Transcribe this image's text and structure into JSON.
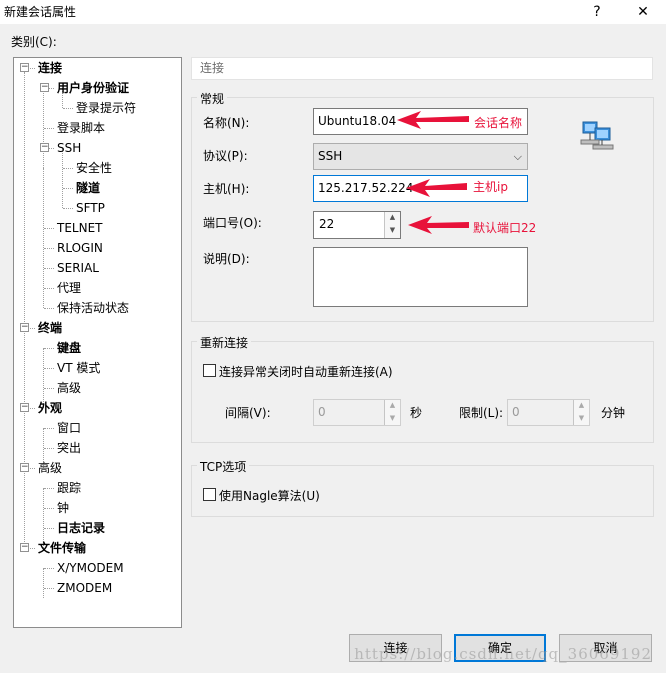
{
  "window": {
    "title": "新建会话属性",
    "help_label": "?",
    "close_label": "✕"
  },
  "category_label": "类别(C):",
  "tree": {
    "items": [
      {
        "label": "连接",
        "bold": true,
        "expander": "−"
      },
      {
        "label": "用户身份验证",
        "bold": true,
        "expander": "−"
      },
      {
        "label": "登录提示符",
        "bold": false
      },
      {
        "label": "登录脚本",
        "bold": false
      },
      {
        "label": "SSH",
        "bold": false,
        "expander": "−"
      },
      {
        "label": "安全性",
        "bold": false
      },
      {
        "label": "隧道",
        "bold": true
      },
      {
        "label": "SFTP",
        "bold": false
      },
      {
        "label": "TELNET",
        "bold": false
      },
      {
        "label": "RLOGIN",
        "bold": false
      },
      {
        "label": "SERIAL",
        "bold": false
      },
      {
        "label": "代理",
        "bold": false
      },
      {
        "label": "保持活动状态",
        "bold": false
      },
      {
        "label": "终端",
        "bold": true,
        "expander": "−"
      },
      {
        "label": "键盘",
        "bold": true
      },
      {
        "label": "VT 模式",
        "bold": false
      },
      {
        "label": "高级",
        "bold": false
      },
      {
        "label": "外观",
        "bold": true,
        "expander": "−"
      },
      {
        "label": "窗口",
        "bold": false
      },
      {
        "label": "突出",
        "bold": false
      },
      {
        "label": "高级",
        "bold": false,
        "expander": "−"
      },
      {
        "label": "跟踪",
        "bold": false
      },
      {
        "label": "钟",
        "bold": false
      },
      {
        "label": "日志记录",
        "bold": true
      },
      {
        "label": "文件传输",
        "bold": true,
        "expander": "−"
      },
      {
        "label": "X/YMODEM",
        "bold": false
      },
      {
        "label": "ZMODEM",
        "bold": false
      }
    ]
  },
  "panel_header": "连接",
  "general": {
    "title": "常规",
    "name_label": "名称(N):",
    "name_value": "Ubuntu18.04",
    "protocol_label": "协议(P):",
    "protocol_value": "SSH",
    "host_label": "主机(H):",
    "host_value": "125.217.52.224",
    "port_label": "端口号(O):",
    "port_value": "22",
    "desc_label": "说明(D):",
    "desc_value": ""
  },
  "annotations": {
    "name": "会话名称",
    "host": "主机ip",
    "port": "默认端口22"
  },
  "reconnect": {
    "title": "重新连接",
    "checkbox_label": "连接异常关闭时自动重新连接(A)",
    "checked": false,
    "interval_label": "间隔(V):",
    "interval_value": "0",
    "interval_unit": "秒",
    "limit_label": "限制(L):",
    "limit_value": "0",
    "limit_unit": "分钟"
  },
  "tcp": {
    "title": "TCP选项",
    "nagle_label": "使用Nagle算法(U)",
    "checked": false
  },
  "buttons": {
    "connect": "连接",
    "ok": "确定",
    "cancel": "取消"
  },
  "watermark": "https://blog.csdn.net/qq_36069192",
  "colors": {
    "accent": "#0078d7",
    "annotation": "#e8123a",
    "window_bg": "#f0f0f0"
  }
}
